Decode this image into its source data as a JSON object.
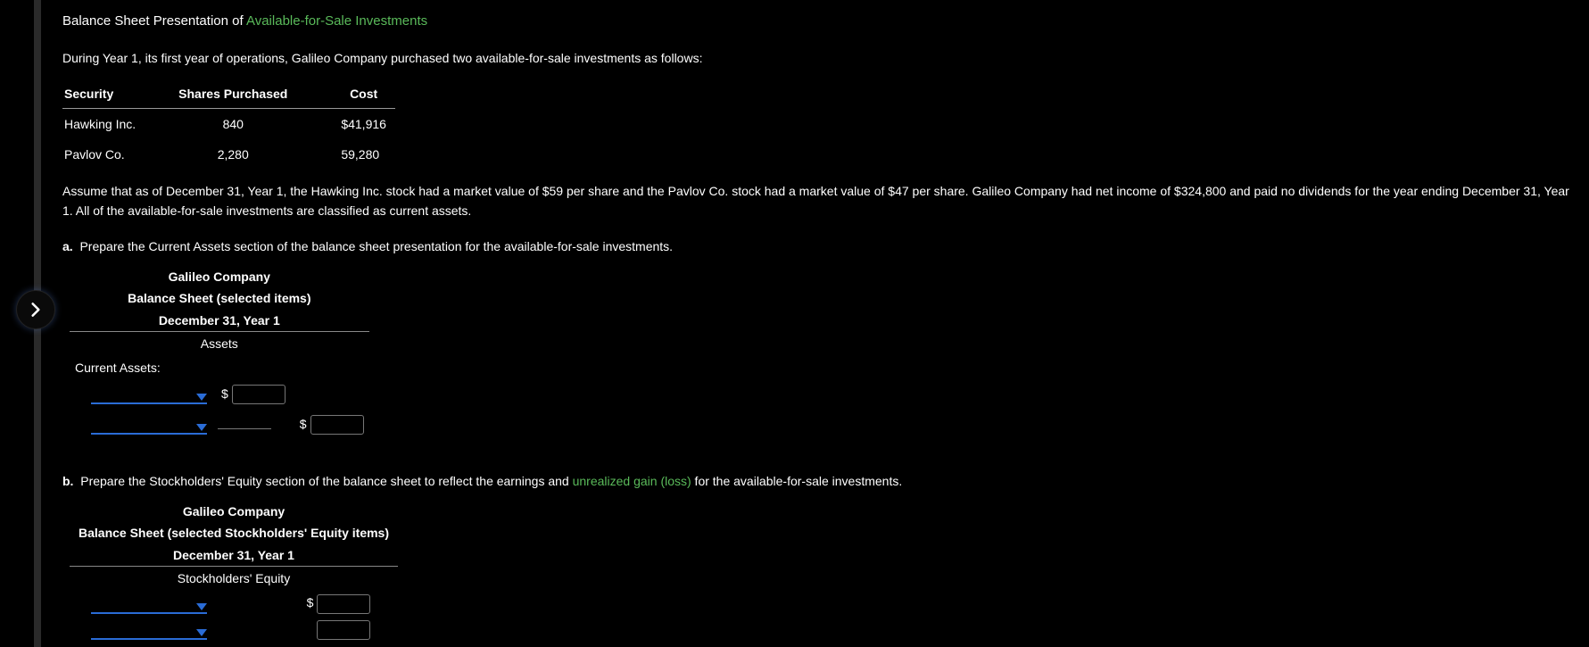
{
  "title_prefix": "Balance Sheet Presentation of ",
  "title_link": "Available-for-Sale Investments",
  "intro": "During Year 1, its first year of operations, Galileo Company purchased two available-for-sale investments as follows:",
  "purchases_table": {
    "headers": [
      "Security",
      "Shares Purchased",
      "Cost"
    ],
    "rows": [
      {
        "security": "Hawking Inc.",
        "shares": "840",
        "cost": "$41,916"
      },
      {
        "security": "Pavlov Co.",
        "shares": "2,280",
        "cost": "59,280"
      }
    ]
  },
  "assumption": "Assume that as of December 31, Year 1, the Hawking Inc. stock had a market value of $59 per share and the Pavlov Co. stock had a market value of $47 per share. Galileo Company had net income of $324,800 and paid no dividends for the year ending December 31, Year 1. All of the available-for-sale investments are classified as current assets.",
  "qa": {
    "label": "a.",
    "text": "Prepare the Current Assets section of the balance sheet presentation for the available-for-sale investments.",
    "header1": "Galileo Company",
    "header2": "Balance Sheet (selected items)",
    "header3": "December 31, Year 1",
    "section": "Assets",
    "row_label": "Current Assets:",
    "dollar": "$"
  },
  "qb": {
    "label": "b.",
    "text_prefix": "Prepare the Stockholders' Equity section of the balance sheet to reflect the earnings and ",
    "link": "unrealized gain (loss)",
    "text_suffix": " for the available-for-sale investments.",
    "header1": "Galileo Company",
    "header2": "Balance Sheet (selected Stockholders' Equity items)",
    "header3": "December 31, Year 1",
    "section": "Stockholders' Equity",
    "dollar": "$"
  }
}
